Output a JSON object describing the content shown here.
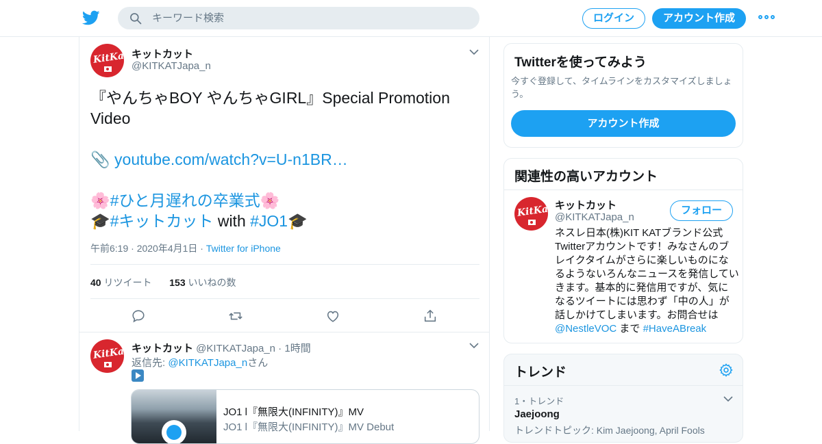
{
  "search": {
    "placeholder": "キーワード検索"
  },
  "header": {
    "login_label": "ログイン",
    "signup_label": "アカウント作成"
  },
  "tweet": {
    "name": "キットカット",
    "handle": "@KITKATJapa_n",
    "text_line1": "『やんちゃBOY やんちゃGIRL』Special Promotion",
    "text_line2": "Video",
    "link": "youtube.com/watch?v=U-n1BR…",
    "hashtag1": "#ひと月遅れの卒業式",
    "hashtag2": "#キットカット",
    "with_text": " with ",
    "hashtag3": "#JO1",
    "timestamp": "午前6:19 · 2020年4月1日 · ",
    "source": "Twitter for iPhone",
    "retweet_count": "40",
    "retweet_label": " リツイート",
    "like_count": "153",
    "like_label": " いいねの数"
  },
  "reply_tweet": {
    "name": "キットカット",
    "handle": " @KITKATJapa_n",
    "time": " · 1時間",
    "reply_prefix": "返信先: ",
    "reply_to": "@KITKATJapa_n",
    "reply_suffix": "さん",
    "card_title": "JO1 l『無限大(INFINITY)』MV",
    "card_desc": "JO1 l『無限大(INFINITY)』MV Debut"
  },
  "try_box": {
    "title": "Twitterを使ってみよう",
    "subtitle_line1": "今すぐ登録して、タイムラインをカスタマイズしましょ",
    "subtitle_line2": "う。",
    "button_label": "アカウント作成"
  },
  "related": {
    "title": "関連性の高いアカウント",
    "name": "キットカット",
    "handle": "@KITKATJapa_n",
    "follow_label": "フォロー",
    "bio_lines": [
      "ネスレ日本(株)KIT KATブランド公式",
      "Twitterアカウントです！みなさんのブ",
      "レイクタイムがさらに楽しいものにな",
      "るようないろんなニュースを発信してい",
      "きます。基本的に発信用ですが、気に",
      "なるツイートには思わず「中の人」が",
      "話しかけてしまいます。お問合せは"
    ],
    "bio_mention": "@NestleVOC",
    "bio_made": " まで ",
    "bio_hashtag": "#HaveABreak"
  },
  "trends": {
    "title": "トレンド",
    "item_meta": "1・トレンド",
    "item_name": "Jaejoong",
    "item_topic": "トレンドトピック: Kim Jaejoong, April Fools"
  },
  "avatar_text": "KitKat",
  "colors": {
    "accent": "#1da1f2",
    "link": "#1b95e0",
    "brand_red": "#d8262e"
  }
}
